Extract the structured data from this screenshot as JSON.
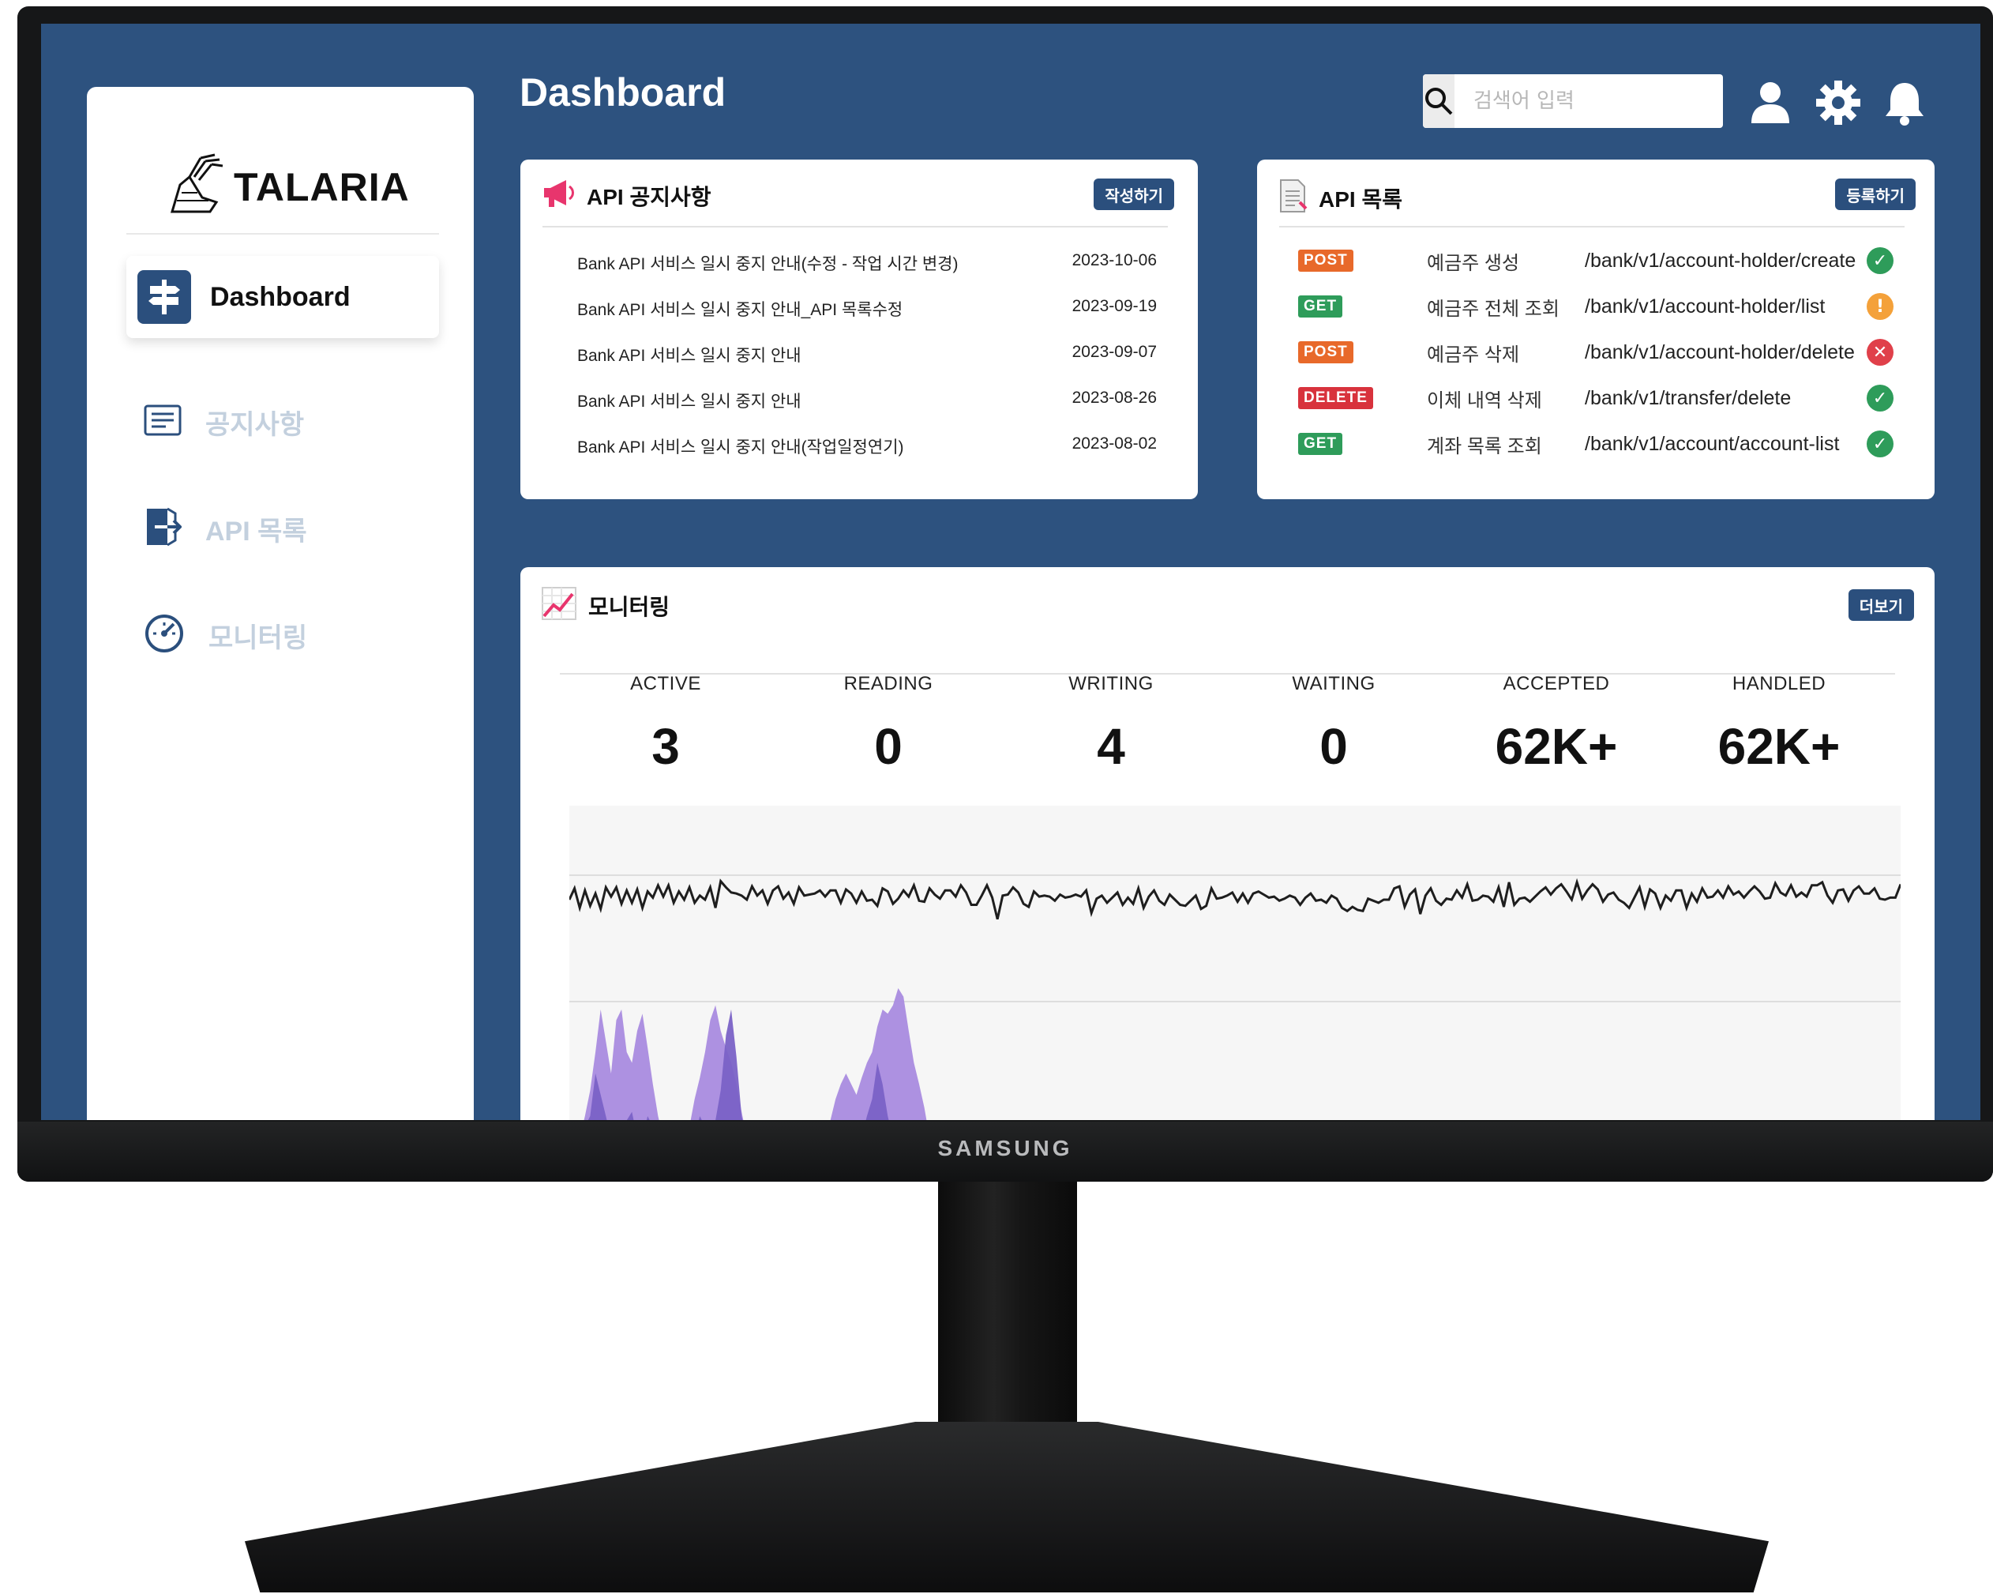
{
  "monitor_brand": "SAMSUNG",
  "sidebar": {
    "logo_text": "TALARIA",
    "active_item": "Dashboard",
    "items": [
      {
        "label": "공지사항",
        "icon": "notice-icon"
      },
      {
        "label": "API 목록",
        "icon": "door-enter-icon"
      },
      {
        "label": "모니터링",
        "icon": "gauge-icon"
      }
    ]
  },
  "header": {
    "title": "Dashboard",
    "search_placeholder": "검색어 입력",
    "icons": [
      "user-icon",
      "gear-icon",
      "bell-icon"
    ]
  },
  "notices": {
    "title": "API 공지사항",
    "button": "작성하기",
    "rows": [
      {
        "title": "Bank API 서비스 일시 중지 안내(수정 - 작업 시간 변경)",
        "date": "2023-10-06"
      },
      {
        "title": "Bank API 서비스 일시 중지 안내_API 목록수정",
        "date": "2023-09-19"
      },
      {
        "title": "Bank API 서비스 일시 중지 안내",
        "date": "2023-09-07"
      },
      {
        "title": "Bank API 서비스 일시 중지 안내",
        "date": "2023-08-26"
      },
      {
        "title": "Bank API 서비스 일시 중지 안내(작업일정연기)",
        "date": "2023-08-02"
      }
    ]
  },
  "apis": {
    "title": "API 목록",
    "button": "등록하기",
    "method_colors": {
      "POST": "#e8692a",
      "GET": "#2e9c5a",
      "DELETE": "#d8323c"
    },
    "status_colors": {
      "ok": "#2e9c5a",
      "warn": "#f4a13a",
      "error": "#e0404a"
    },
    "rows": [
      {
        "method": "POST",
        "name": "예금주 생성",
        "path": "/bank/v1/account-holder/create",
        "status": "ok"
      },
      {
        "method": "GET",
        "name": "예금주 전체 조회",
        "path": "/bank/v1/account-holder/list",
        "status": "warn"
      },
      {
        "method": "POST",
        "name": "예금주 삭제",
        "path": "/bank/v1/account-holder/delete",
        "status": "error"
      },
      {
        "method": "DELETE",
        "name": "이체 내역 삭제",
        "path": "/bank/v1/transfer/delete",
        "status": "ok"
      },
      {
        "method": "GET",
        "name": "계좌 목록 조회",
        "path": "/bank/v1/account/account-list",
        "status": "ok"
      }
    ]
  },
  "monitoring": {
    "title": "모니터링",
    "button": "더보기",
    "stats": [
      {
        "label": "ACTIVE",
        "value": "3"
      },
      {
        "label": "READING",
        "value": "0"
      },
      {
        "label": "WRITING",
        "value": "4"
      },
      {
        "label": "WAITING",
        "value": "0"
      },
      {
        "label": "ACCEPTED",
        "value": "62K+"
      },
      {
        "label": "HANDLED",
        "value": "62K+"
      }
    ]
  },
  "chart_data": {
    "type": "area",
    "grid": true,
    "series_colors": [
      "#1e1e1e",
      "#a98bdf",
      "#7a62c6",
      "#6fb8f0"
    ],
    "line": [
      70,
      81,
      62,
      79,
      64,
      76,
      61,
      82,
      73,
      82,
      66,
      79,
      67,
      80,
      62,
      78,
      72,
      84,
      73,
      84,
      67,
      78,
      70,
      82,
      67,
      74,
      70,
      82,
      62,
      88,
      82,
      77,
      76,
      74,
      70,
      83,
      74,
      79,
      66,
      79,
      83,
      71,
      77,
      66,
      82,
      74,
      75,
      76,
      79,
      73,
      79,
      79,
      67,
      80,
      76,
      67,
      78,
      69,
      70,
      64,
      81,
      78,
      66,
      71,
      79,
      73,
      84,
      69,
      68,
      81,
      75,
      71,
      79,
      79,
      73,
      84,
      77,
      65,
      65,
      74,
      84,
      72,
      51,
      74,
      75,
      82,
      77,
      66,
      63,
      78,
      73,
      74,
      73,
      69,
      75,
      72,
      73,
      75,
      73,
      79,
      57,
      71,
      74,
      67,
      72,
      77,
      65,
      72,
      66,
      81,
      62,
      73,
      79,
      69,
      65,
      75,
      70,
      65,
      64,
      69,
      74,
      61,
      64,
      81,
      71,
      72,
      74,
      77,
      68,
      76,
      67,
      76,
      78,
      75,
      72,
      73,
      69,
      71,
      74,
      72,
      65,
      72,
      76,
      69,
      70,
      67,
      74,
      71,
      62,
      59,
      63,
      60,
      59,
      71,
      69,
      67,
      70,
      70,
      81,
      83,
      63,
      75,
      80,
      56,
      74,
      81,
      69,
      65,
      71,
      70,
      79,
      72,
      85,
      69,
      70,
      74,
      73,
      68,
      82,
      63,
      87,
      65,
      71,
      72,
      68,
      73,
      78,
      82,
      75,
      81,
      85,
      78,
      70,
      87,
      71,
      79,
      85,
      80,
      68,
      75,
      77,
      70,
      67,
      62,
      72,
      82,
      63,
      80,
      76,
      62,
      74,
      69,
      79,
      79,
      62,
      76,
      68,
      81,
      72,
      73,
      79,
      72,
      83,
      75,
      78,
      72,
      78,
      83,
      78,
      71,
      72,
      86,
      77,
      74,
      84,
      73,
      77,
      73,
      84,
      84,
      87,
      74,
      67,
      79,
      80,
      69,
      79,
      83,
      76,
      76,
      81,
      71,
      70,
      72,
      72,
      85
    ],
    "area_light": [
      0,
      0,
      0,
      10,
      22,
      40,
      60,
      45,
      30,
      55,
      60,
      40,
      35,
      50,
      58,
      42,
      25,
      10,
      0,
      0,
      0,
      0,
      0,
      5,
      18,
      28,
      40,
      55,
      62,
      50,
      42,
      35,
      25,
      12,
      0,
      0,
      0,
      0,
      0,
      0,
      0,
      0,
      0,
      0,
      0,
      0,
      0,
      0,
      0,
      0,
      8,
      18,
      25,
      30,
      25,
      20,
      28,
      35,
      40,
      52,
      60,
      58,
      62,
      70,
      66,
      50,
      35,
      25,
      14,
      0,
      0,
      0,
      0,
      0,
      0,
      0,
      0,
      0,
      0,
      0,
      0,
      0,
      0,
      0,
      0,
      0,
      0,
      0,
      0,
      0,
      0,
      0,
      0,
      0,
      0,
      0,
      0,
      0,
      0,
      0,
      0,
      0,
      0,
      0,
      0,
      0,
      0,
      0,
      0,
      0,
      0,
      0,
      0,
      0,
      0,
      0,
      0,
      0,
      0,
      0,
      0,
      0,
      0,
      0,
      0,
      0,
      0,
      0,
      0,
      0,
      0,
      0,
      0,
      0,
      0,
      0,
      0,
      0,
      0,
      0,
      0,
      0,
      0,
      0,
      0,
      0,
      0,
      0,
      0,
      0,
      0,
      0,
      0,
      0,
      0,
      0,
      0,
      0,
      0,
      0,
      0,
      0,
      0,
      0,
      0,
      0,
      0,
      0,
      0,
      0,
      0,
      0,
      0,
      0,
      0,
      0,
      0,
      0,
      0,
      0,
      0,
      0,
      0,
      0,
      0,
      0,
      0,
      0,
      0,
      0,
      0,
      0,
      0,
      0,
      0,
      0,
      0,
      0,
      0,
      0,
      0,
      0,
      0,
      0,
      0,
      0,
      0,
      0,
      0,
      0,
      0,
      0,
      0,
      0,
      0,
      0,
      0,
      0,
      0,
      0,
      0,
      0,
      0,
      0,
      0,
      0,
      0,
      0,
      0,
      0,
      0,
      0,
      0,
      0,
      0,
      0,
      0,
      0,
      0,
      0,
      0,
      0,
      0,
      0,
      0,
      0,
      0,
      0,
      0,
      0,
      0,
      0,
      0,
      0,
      0,
      0,
      0,
      0,
      0,
      0,
      0,
      0,
      0,
      0,
      0,
      0,
      0,
      0,
      0,
      0,
      0,
      0,
      0,
      0,
      0,
      0,
      0,
      0,
      0,
      0,
      0,
      0,
      0,
      0,
      0,
      0,
      0,
      0,
      0,
      0,
      0,
      0,
      0,
      0,
      0,
      0,
      0,
      0,
      0
    ],
    "area_dark": [
      0,
      0,
      0,
      5,
      10,
      30,
      20,
      10,
      0,
      0,
      5,
      8,
      12,
      0,
      0,
      10,
      5,
      0,
      0,
      0,
      0,
      0,
      0,
      0,
      0,
      10,
      5,
      0,
      8,
      22,
      48,
      60,
      38,
      10,
      0,
      0,
      0,
      0,
      0,
      0,
      0,
      0,
      0,
      0,
      0,
      0,
      0,
      0,
      0,
      0,
      0,
      0,
      0,
      0,
      0,
      0,
      0,
      10,
      18,
      35,
      25,
      10,
      0,
      0,
      0,
      0,
      0,
      0,
      0,
      0,
      0,
      0,
      0,
      0,
      0,
      0,
      0,
      0,
      0,
      0,
      0,
      0,
      0,
      0,
      0,
      0,
      0,
      0,
      0,
      0,
      0,
      0,
      0,
      0,
      0,
      0,
      0,
      0,
      0,
      0,
      0,
      0,
      0,
      0,
      0,
      0,
      0,
      0,
      0,
      0,
      0,
      0,
      0,
      0,
      0,
      0,
      0,
      0,
      0,
      0,
      0,
      0,
      0,
      0,
      0,
      0,
      0,
      0,
      0,
      0,
      0,
      0,
      0,
      0,
      0,
      0,
      0,
      0,
      0,
      0,
      0,
      0,
      0,
      0,
      0,
      0,
      0,
      0,
      0,
      0,
      0,
      0,
      0,
      0,
      0,
      0,
      0,
      0,
      0,
      0,
      0,
      0,
      0,
      0,
      0,
      0,
      0,
      0,
      0,
      0,
      0,
      0,
      0,
      0,
      0,
      0,
      0,
      0,
      0,
      0,
      0,
      0,
      0,
      0,
      0,
      0,
      0,
      0,
      0,
      0,
      0,
      0,
      0,
      0,
      0,
      0,
      0,
      0,
      0,
      0,
      0,
      0,
      0,
      0,
      0,
      0,
      0,
      0,
      0,
      0,
      0,
      0,
      0,
      0,
      0,
      0,
      0,
      0,
      0,
      0,
      0,
      0,
      0,
      0,
      0,
      0,
      0,
      0,
      0,
      0,
      0,
      0,
      0,
      0,
      0,
      0,
      0,
      0,
      0,
      0,
      0,
      0,
      0,
      0,
      0,
      0,
      0,
      0,
      0,
      0,
      0,
      0,
      0,
      0,
      0,
      0,
      0,
      0,
      0,
      0,
      0,
      0,
      0,
      0,
      0,
      0,
      0,
      0,
      0
    ],
    "area_blue": [
      0,
      0,
      0,
      0,
      0,
      0,
      0,
      0,
      0,
      0,
      0,
      0,
      0,
      0,
      0,
      0,
      0,
      0,
      0,
      0,
      0,
      0,
      0,
      0,
      0,
      0,
      0,
      0,
      0,
      0,
      0,
      0,
      0,
      0,
      0,
      0,
      0,
      0,
      0,
      0,
      0,
      0,
      0,
      0,
      0,
      0,
      0,
      0,
      0,
      0,
      0,
      0,
      0,
      0,
      0,
      0,
      0,
      0,
      0,
      0,
      0,
      0,
      0,
      0,
      0,
      0,
      0,
      0,
      0,
      0,
      0,
      0,
      0,
      0,
      0,
      0,
      0,
      0,
      0,
      0,
      0,
      0,
      0,
      0,
      0,
      0,
      0,
      0,
      0,
      0,
      0,
      0,
      0,
      0,
      0,
      0,
      0,
      0,
      0,
      0,
      0,
      0,
      0,
      0,
      0,
      0,
      0,
      0,
      0,
      0,
      0,
      0,
      0,
      0,
      0,
      0,
      0,
      0,
      0,
      0,
      0,
      0,
      0,
      0,
      0,
      0,
      0,
      0,
      0,
      0,
      0,
      0,
      0,
      0,
      0,
      0,
      0,
      0,
      0,
      0,
      0,
      0,
      0,
      0,
      0,
      0,
      0,
      0,
      0,
      0,
      0,
      0,
      0,
      0,
      0,
      0,
      0,
      0,
      0,
      0,
      0,
      0,
      0,
      0,
      0,
      0,
      0,
      0,
      0,
      0,
      0,
      0,
      0,
      0,
      0,
      0,
      0,
      0,
      0,
      0,
      0,
      0,
      0,
      0,
      0,
      0,
      0,
      0,
      0,
      0,
      0,
      0,
      0,
      0,
      0,
      0,
      0,
      0,
      0,
      0,
      0,
      0,
      0,
      0,
      0,
      0,
      0,
      0,
      0,
      0,
      0,
      0,
      0,
      0,
      0,
      0,
      0,
      0,
      0,
      0,
      0,
      0,
      0,
      0,
      0,
      0,
      0,
      0,
      0,
      0,
      0,
      0,
      0,
      0,
      0,
      0,
      0,
      0,
      0,
      0,
      0,
      0,
      0,
      0,
      0,
      0,
      0,
      0,
      0,
      0,
      0,
      0,
      0,
      0,
      0,
      0,
      0,
      0,
      0,
      0,
      0,
      0,
      0,
      0,
      0,
      0,
      0,
      0,
      0,
      0,
      0,
      0,
      0,
      0,
      0
    ]
  }
}
